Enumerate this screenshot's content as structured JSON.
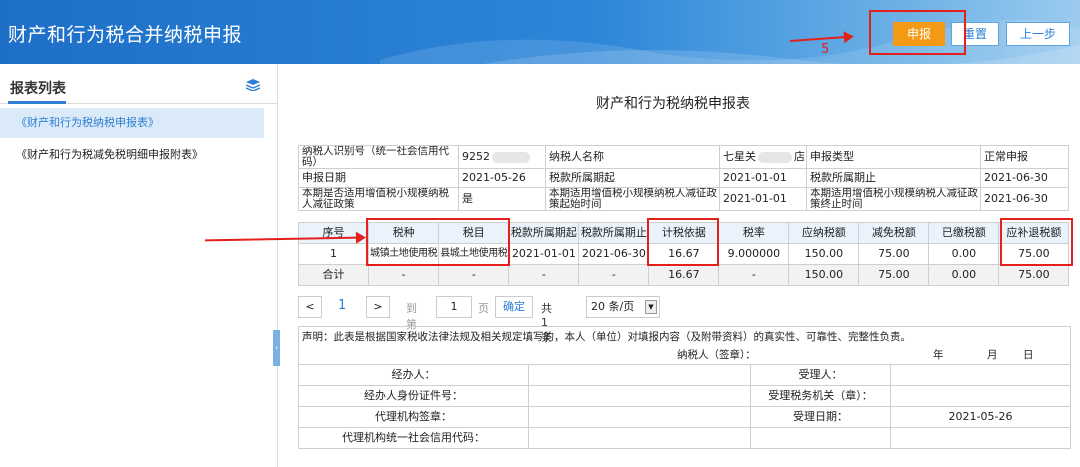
{
  "app_title": "财产和行为税合并纳税申报",
  "toolbar": {
    "submit_label": "申报",
    "reset_label": "重置",
    "prev_label": "上一步",
    "step_number": "5"
  },
  "sidebar": {
    "title": "报表列表",
    "items": [
      {
        "label": "《财产和行为税纳税申报表》",
        "active": true
      },
      {
        "label": "《财产和行为税减免税明细申报附表》",
        "active": false
      }
    ]
  },
  "form_title": "财产和行为税纳税申报表",
  "info": {
    "taxpayer_id_label": "纳税人识别号（统一社会信用代码）",
    "taxpayer_id_value": "9252",
    "taxpayer_name_label": "纳税人名称",
    "taxpayer_name_value": "七星关",
    "taxpayer_name_suffix": "店",
    "declare_type_label": "申报类型",
    "declare_type_value": "正常申报",
    "declare_date_label": "申报日期",
    "declare_date_value": "2021-05-26",
    "period_start_label": "税款所属期起",
    "period_start_value": "2021-01-01",
    "period_end_label": "税款所属期止",
    "period_end_value": "2021-06-30",
    "small_scale_label": "本期是否适用增值税小规模纳税人减征政策",
    "small_scale_value": "是",
    "policy_start_label": "本期适用增值税小规模纳税人减征政策起始时间",
    "policy_start_value": "2021-01-01",
    "policy_end_label": "本期适用增值税小规模纳税人减征政策终止时间",
    "policy_end_value": "2021-06-30"
  },
  "detail": {
    "headers": [
      "序号",
      "税种",
      "税目",
      "税款所属期起",
      "税款所属期止",
      "计税依据",
      "税率",
      "应纳税额",
      "减免税额",
      "已缴税额",
      "应补退税额"
    ],
    "rows": [
      [
        "1",
        "城镇土地使用税",
        "县城土地使用税",
        "2021-01-01",
        "2021-06-30",
        "16.67",
        "9.000000",
        "150.00",
        "75.00",
        "0.00",
        "75.00"
      ]
    ],
    "total": [
      "合计",
      "-",
      "-",
      "-",
      "-",
      "16.67",
      "-",
      "150.00",
      "75.00",
      "0.00",
      "75.00"
    ]
  },
  "pager": {
    "prev": "<",
    "current_page": "1",
    "next": ">",
    "goto_label": "到第",
    "goto_value": "1",
    "page_unit": "页",
    "confirm": "确定",
    "total_text": "共 1 条",
    "page_size": "20 条/页"
  },
  "declaration": {
    "statement": "声明：此表是根据国家税收法律法规及相关规定填写的，本人（单位）对填报内容（及附带资料）的真实性、可靠性、完整性负责。",
    "signer_label": "纳税人（签章）：",
    "year": "年",
    "month": "月",
    "day": "日",
    "handler_label": "经办人：",
    "receiver_label": "受理人：",
    "handler_id_label": "经办人身份证件号：",
    "receiving_office_label": "受理税务机关（章）：",
    "agency_seal_label": "代理机构签章：",
    "receive_date_label": "受理日期：",
    "receive_date_value": "2021-05-26",
    "agency_credit_label": "代理机构统一社会信用代码："
  },
  "colors": {
    "header_blue": "#2d86d9",
    "submit_orange": "#f59a14",
    "annotation_red": "#e3201c",
    "accent": "#2d7fd4"
  }
}
